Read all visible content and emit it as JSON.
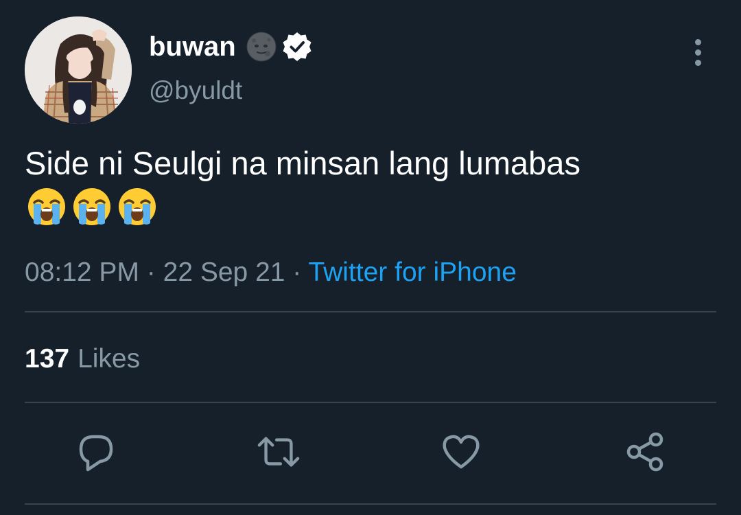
{
  "author": {
    "display_name": "buwan",
    "handle": "@byuldt",
    "name_emoji": "new-moon-face-emoji",
    "verified": true
  },
  "tweet": {
    "text": "Side ni Seulgi na minsan lang lumabas",
    "emojis": [
      "loudly-crying-face-emoji",
      "loudly-crying-face-emoji",
      "loudly-crying-face-emoji"
    ],
    "time": "08:12 PM",
    "date": "22 Sep 21",
    "separator": "·",
    "source": "Twitter for iPhone"
  },
  "stats": {
    "likes_count": "137",
    "likes_label": "Likes"
  },
  "actions": [
    "reply-icon",
    "retweet-icon",
    "like-icon",
    "share-icon"
  ],
  "colors": {
    "background": "#15202b",
    "text_primary": "#ffffff",
    "text_secondary": "#8899a6",
    "link": "#1da1f2",
    "divider": "#38444d"
  }
}
